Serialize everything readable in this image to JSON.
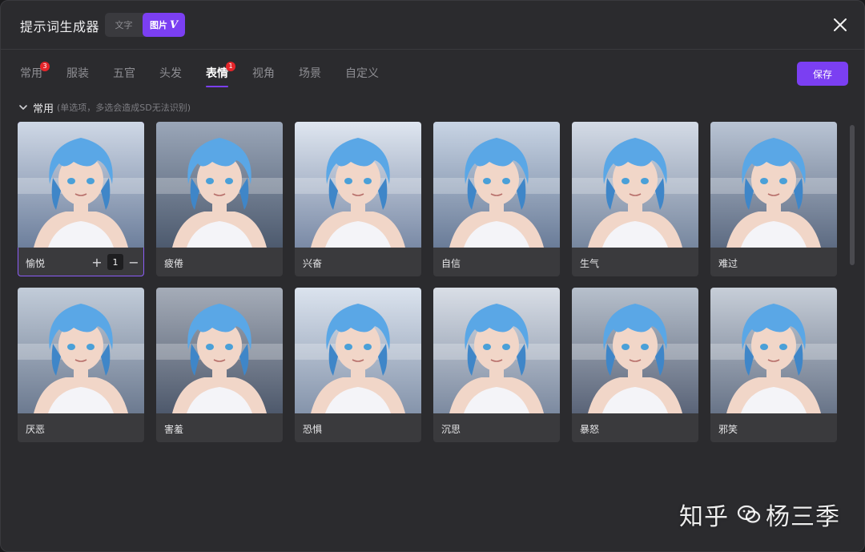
{
  "header": {
    "title": "提示词生成器",
    "mode_text": "文字",
    "mode_image": "图片",
    "mode_image_mark": "V",
    "close_icon": "close-icon"
  },
  "tabs": [
    {
      "label": "常用",
      "badge": "3",
      "active": false
    },
    {
      "label": "服装",
      "badge": "",
      "active": false
    },
    {
      "label": "五官",
      "badge": "",
      "active": false
    },
    {
      "label": "头发",
      "badge": "",
      "active": false
    },
    {
      "label": "表情",
      "badge": "1",
      "active": true
    },
    {
      "label": "视角",
      "badge": "",
      "active": false
    },
    {
      "label": "场景",
      "badge": "",
      "active": false
    },
    {
      "label": "自定义",
      "badge": "",
      "active": false
    }
  ],
  "save_label": "保存",
  "section": {
    "title": "常用",
    "note": "(单选项，多选会造成SD无法识别)"
  },
  "cards": [
    {
      "label": "愉悦",
      "selected": true,
      "count": "1",
      "plus": "+",
      "minus": "−"
    },
    {
      "label": "疲倦",
      "selected": false
    },
    {
      "label": "兴奋",
      "selected": false
    },
    {
      "label": "自信",
      "selected": false
    },
    {
      "label": "生气",
      "selected": false
    },
    {
      "label": "难过",
      "selected": false
    },
    {
      "label": "厌恶",
      "selected": false
    },
    {
      "label": "害羞",
      "selected": false
    },
    {
      "label": "恐惧",
      "selected": false
    },
    {
      "label": "沉思",
      "selected": false
    },
    {
      "label": "暴怒",
      "selected": false
    },
    {
      "label": "邪笑",
      "selected": false
    }
  ],
  "watermark": {
    "text_left": "知乎",
    "text_right": "杨三季"
  },
  "colors": {
    "accent": "#7b3ff2",
    "badge": "#e5252a",
    "hair": "#5aa7e6",
    "background": "#2b2b2e",
    "card": "#3a3a3d"
  }
}
